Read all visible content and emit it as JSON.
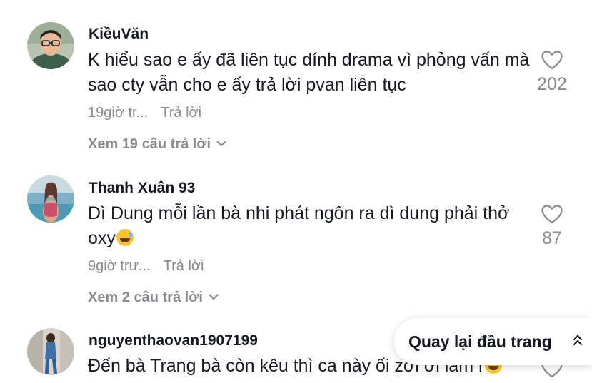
{
  "comments": [
    {
      "username": "KiềuVăn",
      "text": "K hiểu sao e ấy đã liên tục dính drama vì phỏng vấn mà sao cty vẫn cho e ấy trả lời pvan liên tục",
      "time": "19giờ tr...",
      "reply_label": "Trả lời",
      "likes": "202",
      "view_replies": "Xem 19 câu trả lời"
    },
    {
      "username": "Thanh Xuân 93",
      "text": "Dì Dung mỗi lần bà nhi phát ngôn ra dì dung phải thở oxy",
      "time": "9giờ trư...",
      "reply_label": "Trả lời",
      "likes": "87",
      "view_replies": "Xem 2 câu trả lời"
    },
    {
      "username": "nguyenthaovan1907199",
      "text": "Đến bà Trang bà còn kêu thì ca này ối zời ơi lắm r"
    }
  ],
  "back_to_top": {
    "label": "Quay lại đầu trang"
  },
  "icons": {
    "like": "heart-outline-icon",
    "expand": "chevron-down-icon",
    "back_to_top": "double-chevron-up-icon",
    "emoji": "grinning-sweat-emoji"
  },
  "colors": {
    "primary_text": "#161823",
    "secondary_text": "#8a8b91"
  }
}
